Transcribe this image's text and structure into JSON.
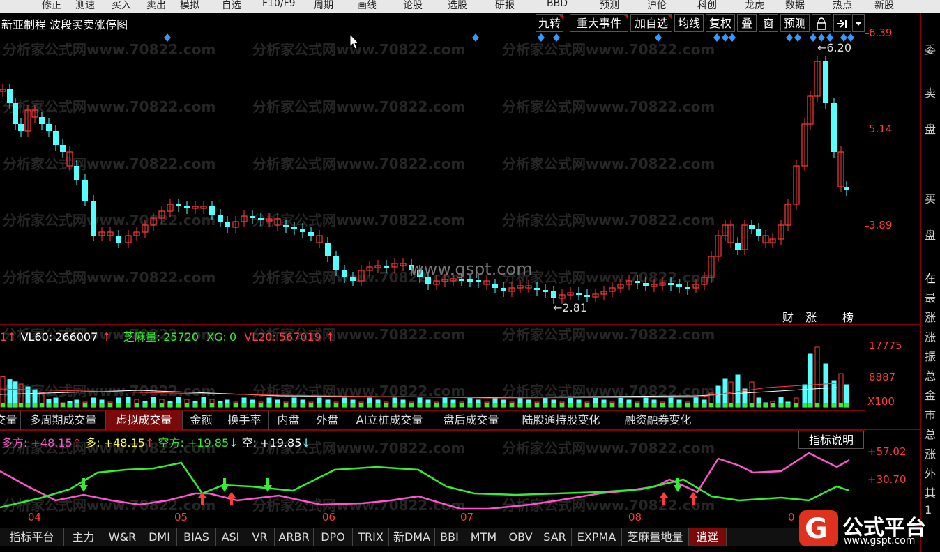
{
  "top_menu": [
    "修正",
    "测速",
    "买入",
    "卖出",
    "模拟",
    "自选",
    "F10/F9",
    "周期",
    "画线",
    "论股",
    "选股",
    "研报",
    "BBD",
    "预测",
    "沪伦",
    "科创",
    "龙虎",
    "数据",
    "热点",
    "新股"
  ],
  "stock": {
    "name": "新亚制程",
    "chart_title": "波段买卖涨停图"
  },
  "toolbar": [
    "九转",
    "重大事件",
    "加自选",
    "均线",
    "复权",
    "叠",
    "窗",
    "预测",
    "lock-icon",
    "jump-end-icon",
    "dropdown-icon"
  ],
  "price_axis": [
    "6.39",
    "5.14",
    "3.89"
  ],
  "price_annotations": {
    "high": "6.20",
    "low": "2.81"
  },
  "center_watermark": "www.gspt.com",
  "watermark_text": "分析家公式网www.70822.com",
  "events": [
    "财",
    "涨",
    "榜"
  ],
  "volume_legend": {
    "prefix": "1↑",
    "vl60_label": "VL60:",
    "vl60": "266007",
    "zhima_label": "芝麻量:",
    "zhima": "25720",
    "xg_label": "XG:",
    "xg": "0",
    "vl20_label": "VL20:",
    "vl20": "567019"
  },
  "volume_axis": [
    "17775",
    "8887",
    "X100"
  ],
  "volume_tabs": [
    "交量",
    "多周期成交量",
    "虚拟成交量",
    "金额",
    "换手率",
    "内盘",
    "外盘",
    "AI立桩成交量",
    "盘后成交量",
    "陆股通持股变化",
    "融资融券变化"
  ],
  "volume_tab_active": 2,
  "indicator_legend": {
    "duofang_label": "多方:",
    "duofang": "+48.15",
    "duo_label": "多:",
    "duo": "+48.15",
    "kongfang_label": "空方:",
    "kongfang": "+19.85",
    "kong_label": "空:",
    "kong": "+19.85"
  },
  "indicator_button": "指标说明",
  "indicator_axis": [
    "+57.02",
    "+30.70"
  ],
  "months": [
    "04",
    "05",
    "06",
    "07",
    "08",
    "0"
  ],
  "bottom_tabs": [
    "指标平台",
    "主力",
    "W&R",
    "DMI",
    "BIAS",
    "ASI",
    "VR",
    "ARBR",
    "DPO",
    "TRIX",
    "新DMA",
    "BBI",
    "MTM",
    "OBV",
    "SAR",
    "EXPMA",
    "芝麻量地量",
    "逍遥"
  ],
  "bottom_tab_active": 17,
  "side_labels": [
    "委",
    "卖",
    "盘",
    "买",
    "盘",
    "在",
    "最",
    "涨",
    "涨",
    "振",
    "总",
    "金",
    "市",
    "总",
    "涨",
    "外",
    "其",
    "1"
  ],
  "logo": {
    "main": "公式平台",
    "sub": "www.gspt.com"
  },
  "colors": {
    "up": "#ff3b3b",
    "down": "#54ffff",
    "bg": "#000000",
    "grid": "#880000",
    "bull_line": "#ff55cc",
    "bear_line": "#33ee33"
  },
  "chart_data": {
    "type": "candlestick",
    "price_axis_ticks": [
      6.39,
      5.14,
      3.89
    ],
    "high_marker": 6.2,
    "low_marker": 2.81,
    "volume_axis_ticks": [
      17775,
      8887
    ],
    "indicator_axis_ticks": [
      57.02,
      30.7
    ],
    "month_ticks": [
      "04",
      "05",
      "06",
      "07",
      "08"
    ]
  }
}
